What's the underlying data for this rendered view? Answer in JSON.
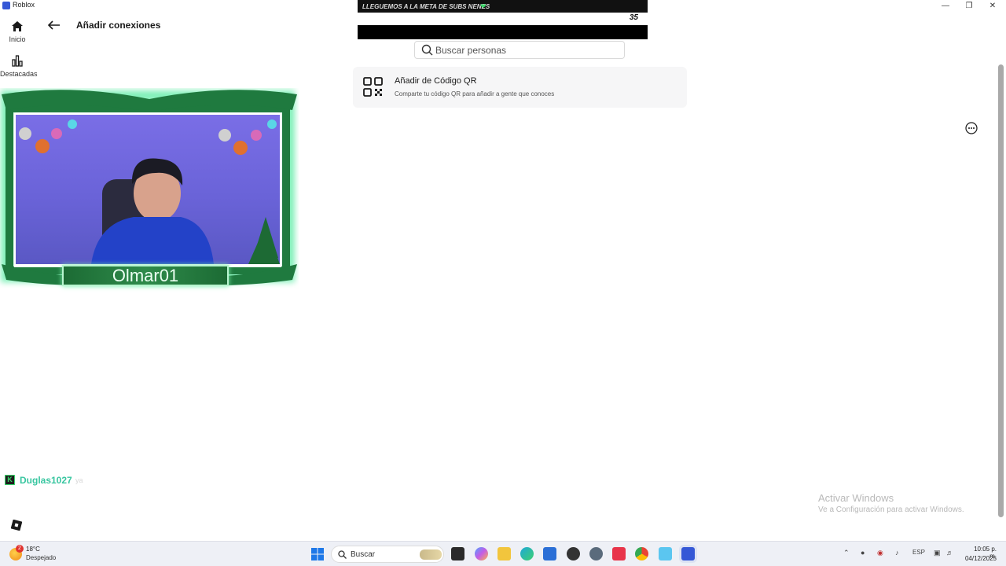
{
  "window": {
    "title": "Roblox"
  },
  "nav": {
    "home_label": "Inicio",
    "featured_label": "Destacadas"
  },
  "header": {
    "title": "Añadir conexiones"
  },
  "banner": {
    "text": "LLEGUEMOS A LA META DE SUBS NENES",
    "count": "35"
  },
  "search": {
    "placeholder": "Buscar personas",
    "value": ""
  },
  "qr_card": {
    "title": "Añadir de Código QR",
    "subtitle": "Comparte tu código QR para añadir a gente que conoces"
  },
  "webcam": {
    "name": "Olmar01"
  },
  "chat": {
    "badge": "K",
    "username": "Duglas1027",
    "message": "ya"
  },
  "watermark": {
    "title": "Activar Windows",
    "subtitle": "Ve a Configuración para activar Windows."
  },
  "taskbar": {
    "weather_badge": "2",
    "temperature": "18°C",
    "condition": "Despejado",
    "search_label": "Buscar",
    "language": "ESP",
    "time": "10:05 p. m.",
    "date": "04/12/2025"
  },
  "colors": {
    "accent": "#3558d6",
    "nameplate_green": "#2e8a4a",
    "chat_username": "#38c6a0"
  }
}
